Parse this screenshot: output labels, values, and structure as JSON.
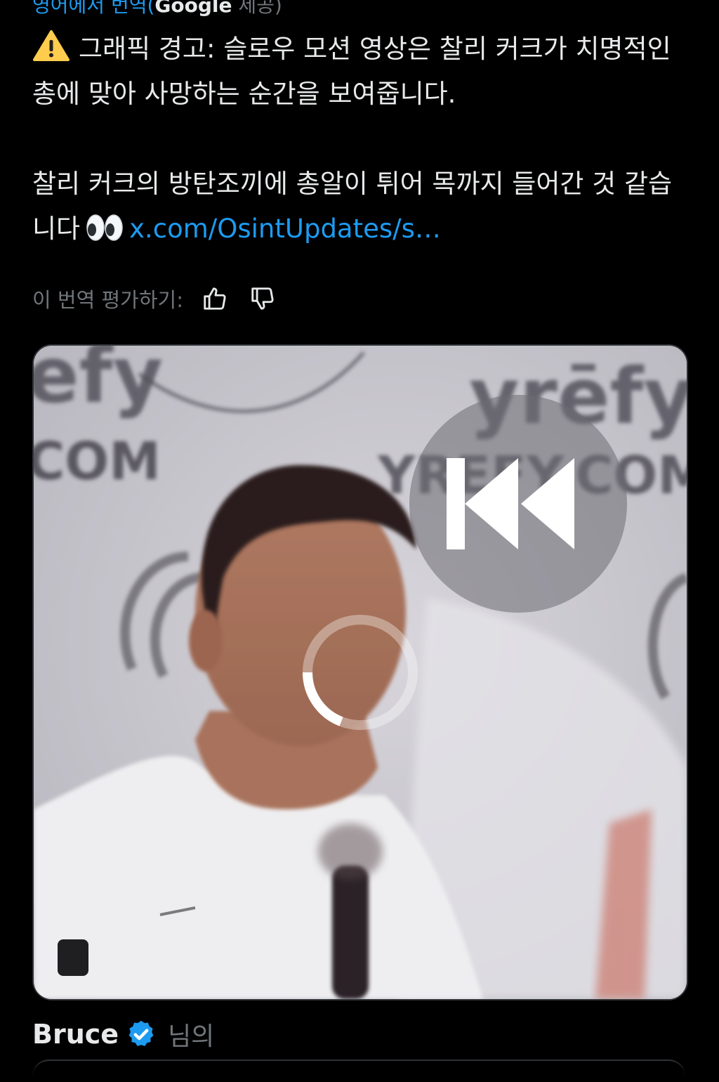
{
  "translation": {
    "label": "영어에서 번역(",
    "provider": "Google",
    "suffix": " 제공)"
  },
  "tweet": {
    "paragraph1": "그래픽 경고: 슬로우 모션 영상은 찰리 커크가 치명적인 총에 맞아 사망하는 순간을 보여줍니다.",
    "paragraph2": "찰리 커크의 방탄조끼에 총알이 튀어 목까지 들어간 것 같습니다",
    "link": "x.com/OsintUpdates/s…"
  },
  "rating": {
    "label": "이 번역 평가하기:"
  },
  "media": {
    "wall_text_left": "efy",
    "wall_com_left": "COM",
    "wall_text_right": "yrēfy",
    "wall_com_right": "YREFY.COM",
    "state": "loading",
    "icons": [
      "rewind-icon",
      "loading-spinner",
      "stop-icon"
    ]
  },
  "footer": {
    "author": "Bruce",
    "possessive": "님의"
  },
  "colors": {
    "background": "#000000",
    "text": "#e7e9ea",
    "link": "#1d9bf0",
    "muted": "#71767b",
    "verified": "#1d9bf0"
  }
}
